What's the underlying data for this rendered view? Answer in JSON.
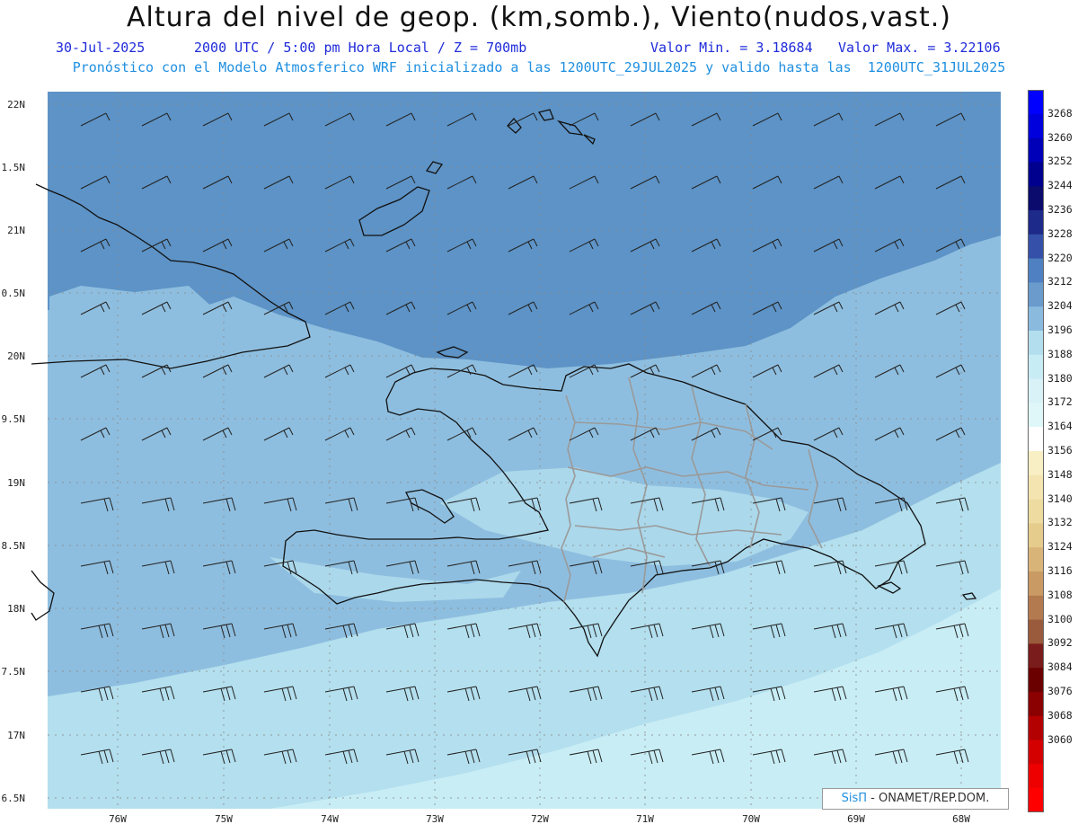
{
  "header": {
    "title": "Altura del nivel de geop. (km,somb.), Viento(nudos,vast.)",
    "date": "30-Jul-2025",
    "time": "2000 UTC / 5:00 pm Hora Local / Z = 700mb",
    "vmin": "Valor Min. = 3.18684",
    "vmax": "Valor Max. = 3.22106",
    "forecast": "Pronóstico con el Modelo Atmosferico WRF inicializado a las 1200UTC_29JUL2025 y valido hasta las  1200UTC_31JUL2025"
  },
  "credit": {
    "brand": "SisΠ",
    "text": " - ONAMET/REP.DOM."
  },
  "axes": {
    "lat_labels": [
      "22N",
      "1.5N",
      "21N",
      "0.5N",
      "20N",
      "9.5N",
      "19N",
      "8.5N",
      "18N",
      "7.5N",
      "17N",
      "6.5N"
    ],
    "lon_labels": [
      "76W",
      "75W",
      "74W",
      "73W",
      "72W",
      "71W",
      "70W",
      "69W",
      "68W"
    ]
  },
  "colorbar": {
    "labels": [
      "3268",
      "3260",
      "3252",
      "3244",
      "3236",
      "3228",
      "3220",
      "3212",
      "3204",
      "3196",
      "3188",
      "3180",
      "3172",
      "3164",
      "3156",
      "3148",
      "3140",
      "3132",
      "3124",
      "3116",
      "3108",
      "3100",
      "3092",
      "3084",
      "3076",
      "3068",
      "3060"
    ],
    "colors": [
      "#0000ff",
      "#0000dd",
      "#0000b8",
      "#00008f",
      "#0b0b6e",
      "#1e2a8a",
      "#3450a8",
      "#4f80c2",
      "#6a9bcc",
      "#8bbadf",
      "#b3deee",
      "#c8ecf4",
      "#d8f2f7",
      "#e0f7f9",
      "#ffffff",
      "#f8efc4",
      "#f3e4b0",
      "#eddb9f",
      "#e6cc8c",
      "#d9b479",
      "#c99a64",
      "#b27a4e",
      "#9a5a3c",
      "#7a1c1c",
      "#6b0000",
      "#8b0000",
      "#b30000",
      "#d40000",
      "#ef0000",
      "#ff0000"
    ],
    "map_colors": {
      "high": "#5d93c6",
      "mid": "#8ebedf",
      "low": "#b3dfee",
      "lowest": "#c8edf5"
    }
  }
}
